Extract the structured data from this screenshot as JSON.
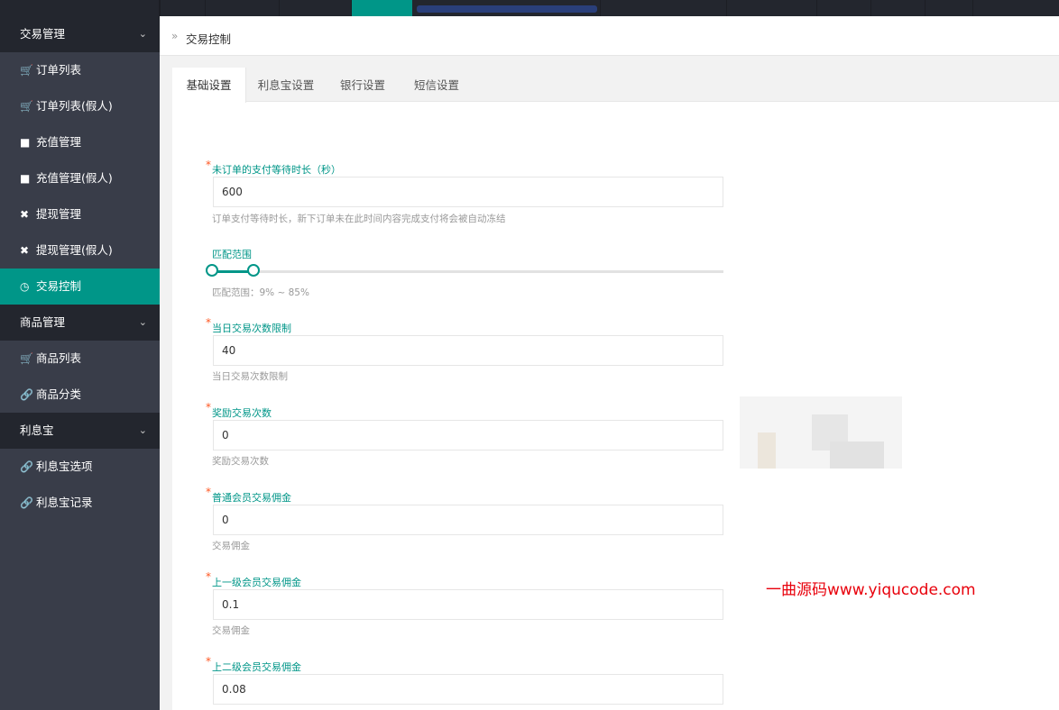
{
  "topbar": {
    "accent": "#009688"
  },
  "sidebar": {
    "groups": [
      {
        "label": "交易管理",
        "items": [
          {
            "label": "订单列表",
            "icon": "cart-icon"
          },
          {
            "label": "订单列表(假人)",
            "icon": "cart-icon"
          },
          {
            "label": "充值管理",
            "icon": "money-icon"
          },
          {
            "label": "充值管理(假人)",
            "icon": "money-icon"
          },
          {
            "label": "提现管理",
            "icon": "gavel-icon"
          },
          {
            "label": "提现管理(假人)",
            "icon": "gavel-icon"
          },
          {
            "label": "交易控制",
            "icon": "dashboard-icon",
            "active": true
          }
        ]
      },
      {
        "label": "商品管理",
        "items": [
          {
            "label": "商品列表",
            "icon": "shopping-cart-icon"
          },
          {
            "label": "商品分类",
            "icon": "link-icon"
          }
        ]
      },
      {
        "label": "利息宝",
        "items": [
          {
            "label": "利息宝选项",
            "icon": "link-icon"
          },
          {
            "label": "利息宝记录",
            "icon": "link-icon"
          }
        ]
      }
    ]
  },
  "breadcrumb": {
    "separator": "»",
    "current": "交易控制"
  },
  "tabs": [
    "基础设置",
    "利息宝设置",
    "银行设置",
    "短信设置"
  ],
  "form": {
    "wait_time": {
      "label": "未订单的支付等待时长（秒）",
      "value": "600",
      "hint": "订单支付等待时长，新下订单未在此时间内容完成支付将会被自动冻结"
    },
    "match_range": {
      "label": "匹配范围",
      "hint": "匹配范围：9% ~ 85%",
      "min_percent": 9,
      "max_percent": 85
    },
    "daily_limit": {
      "label": "当日交易次数限制",
      "value": "40",
      "hint": "当日交易次数限制"
    },
    "bonus_count": {
      "label": "奖励交易次数",
      "value": "0",
      "hint": "奖励交易次数"
    },
    "member_commission": {
      "label": "普通会员交易佣金",
      "value": "0",
      "hint": "交易佣金"
    },
    "level1_commission": {
      "label": "上一级会员交易佣金",
      "value": "0.1",
      "hint": "交易佣金"
    },
    "level2_commission": {
      "label": "上二级会员交易佣金",
      "value": "0.08"
    }
  },
  "watermark": "一曲源码www.yiqucode.com"
}
